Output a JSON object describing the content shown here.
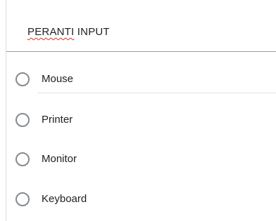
{
  "question": {
    "title_underlined": "PERANTI",
    "title_rest": " INPUT"
  },
  "options": [
    {
      "label": "Mouse",
      "selected": false
    },
    {
      "label": "Printer",
      "selected": false
    },
    {
      "label": "Monitor",
      "selected": false
    },
    {
      "label": "Keyboard",
      "selected": false
    }
  ]
}
